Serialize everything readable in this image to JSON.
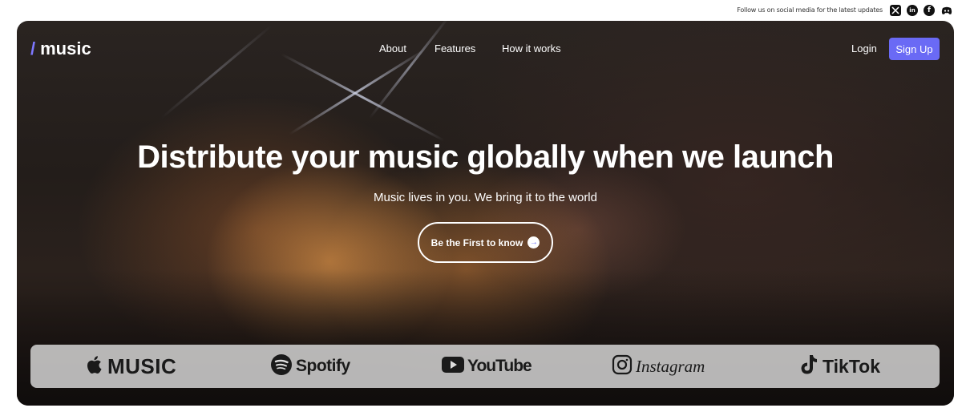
{
  "topbar": {
    "follow_text": "Follow us on social media for the latest updates",
    "social": [
      {
        "icon": "x-icon",
        "glyph": "𝕏"
      },
      {
        "icon": "linkedin-icon",
        "glyph": "in"
      },
      {
        "icon": "facebook-icon",
        "glyph": "f"
      },
      {
        "icon": "discord-icon",
        "glyph": ""
      }
    ]
  },
  "brand": {
    "slash": "/",
    "name": "music",
    "accent_color": "#7e78ff"
  },
  "nav": {
    "about": "About",
    "features": "Features",
    "how_it_works": "How it works",
    "login": "Login",
    "signup": "Sign Up",
    "signup_color": "#6a6af5"
  },
  "hero": {
    "headline": "Distribute your music globally when we launch",
    "subline": "Music lives in you. We bring it to the world",
    "cta_label": "Be the First to know",
    "cta_icon": "arrow-right-icon"
  },
  "platforms": [
    {
      "name": "MUSIC",
      "icon": "apple-icon"
    },
    {
      "name": "Spotify",
      "icon": "spotify-icon"
    },
    {
      "name": "YouTube",
      "icon": "youtube-icon"
    },
    {
      "name": "Instagram",
      "icon": "instagram-icon"
    },
    {
      "name": "TikTok",
      "icon": "tiktok-icon"
    }
  ]
}
